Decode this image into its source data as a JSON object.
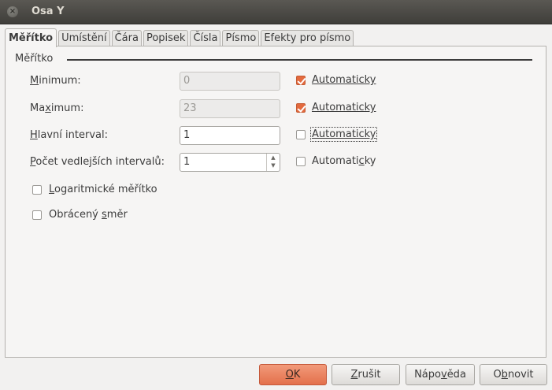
{
  "window": {
    "title": "Osa Y",
    "close_glyph": "×"
  },
  "tabs": [
    {
      "label": "Měřítko",
      "active": true
    },
    {
      "label": "Umístění",
      "active": false
    },
    {
      "label": "Čára",
      "active": false
    },
    {
      "label": "Popisek",
      "active": false
    },
    {
      "label": "Čísla",
      "active": false
    },
    {
      "label": "Písmo",
      "active": false
    },
    {
      "label": "Efekty pro písmo",
      "active": false
    }
  ],
  "scale": {
    "section_title": "Měřítko",
    "minimum": {
      "label_u": "M",
      "label_rest": "inimum:",
      "value": "0",
      "auto_label": "Automaticky",
      "auto_checked": true
    },
    "maximum": {
      "label_pre": "Ma",
      "label_u": "x",
      "label_rest": "imum:",
      "value": "23",
      "auto_label": "Automaticky",
      "auto_checked": true
    },
    "major": {
      "label_u": "H",
      "label_rest": "lavní interval:",
      "value": "1",
      "auto_label": "Automaticky",
      "auto_checked": false
    },
    "minor": {
      "label_u": "P",
      "label_rest": "očet vedlejších intervalů:",
      "value": "1",
      "auto_pre": "Automati",
      "auto_u": "c",
      "auto_rest": "ky",
      "auto_checked": false
    },
    "logarithmic": {
      "label_u": "L",
      "label_rest": "ogaritmické měřítko",
      "checked": false
    },
    "reverse": {
      "label_pre": "Obrácený ",
      "label_u": "s",
      "label_rest": "měr",
      "checked": false
    }
  },
  "spin": {
    "up": "▲",
    "down": "▼"
  },
  "buttons": {
    "ok": {
      "label_u": "O",
      "label_rest": "K"
    },
    "cancel": {
      "label_u": "Z",
      "label_rest": "rušit"
    },
    "help": {
      "label_pre": "Nápo",
      "label_u": "v",
      "label_rest": "ěda"
    },
    "reset": {
      "label_pre": "O",
      "label_u": "b",
      "label_rest": "novit"
    }
  },
  "colors": {
    "accent": "#e36a3e",
    "titlebar": "#3f3e3a"
  }
}
